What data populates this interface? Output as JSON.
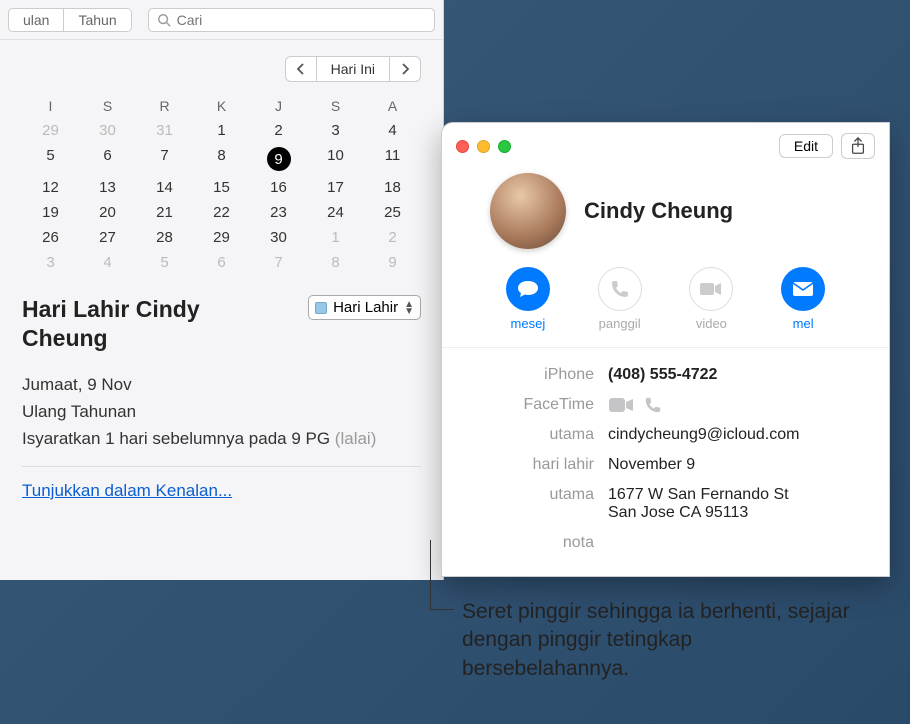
{
  "calendar": {
    "tabs": [
      "ulan",
      "Tahun"
    ],
    "search_placeholder": "Cari",
    "nav": {
      "today": "Hari Ini"
    },
    "dow": [
      "I",
      "S",
      "R",
      "K",
      "J",
      "S",
      "A"
    ],
    "weeks": [
      [
        {
          "d": "29",
          "dim": true
        },
        {
          "d": "30",
          "dim": true
        },
        {
          "d": "31",
          "dim": true
        },
        {
          "d": "1"
        },
        {
          "d": "2"
        },
        {
          "d": "3"
        },
        {
          "d": "4"
        }
      ],
      [
        {
          "d": "5"
        },
        {
          "d": "6"
        },
        {
          "d": "7"
        },
        {
          "d": "8"
        },
        {
          "d": "9",
          "today": true
        },
        {
          "d": "10"
        },
        {
          "d": "11"
        }
      ],
      [
        {
          "d": "12"
        },
        {
          "d": "13"
        },
        {
          "d": "14"
        },
        {
          "d": "15"
        },
        {
          "d": "16"
        },
        {
          "d": "17"
        },
        {
          "d": "18"
        }
      ],
      [
        {
          "d": "19"
        },
        {
          "d": "20"
        },
        {
          "d": "21"
        },
        {
          "d": "22"
        },
        {
          "d": "23"
        },
        {
          "d": "24"
        },
        {
          "d": "25"
        }
      ],
      [
        {
          "d": "26"
        },
        {
          "d": "27"
        },
        {
          "d": "28"
        },
        {
          "d": "29"
        },
        {
          "d": "30"
        },
        {
          "d": "1",
          "dim": true
        },
        {
          "d": "2",
          "dim": true
        }
      ],
      [
        {
          "d": "3",
          "dim": true
        },
        {
          "d": "4",
          "dim": true
        },
        {
          "d": "5",
          "dim": true
        },
        {
          "d": "6",
          "dim": true
        },
        {
          "d": "7",
          "dim": true
        },
        {
          "d": "8",
          "dim": true
        },
        {
          "d": "9",
          "dim": true
        }
      ]
    ],
    "event_title": "Hari Lahir Cindy Cheung",
    "event_category": "Hari Lahir",
    "detail_date": "Jumaat, 9 Nov",
    "detail_repeat": "Ulang Tahunan",
    "detail_alert_prefix": "Isyaratkan 1 hari sebelumnya pada 9 PG ",
    "detail_alert_suffix": "(lalai)",
    "show_link": "Tunjukkan dalam Kenalan..."
  },
  "contacts": {
    "edit": "Edit",
    "name": "Cindy Cheung",
    "actions": {
      "message": "mesej",
      "call": "panggil",
      "video": "video",
      "mail": "mel"
    },
    "fields": {
      "iphone_label": "iPhone",
      "iphone_value": "(408) 555-4722",
      "facetime_label": "FaceTime",
      "email_label": "utama",
      "email_value": "cindycheung9@icloud.com",
      "bday_label": "hari lahir",
      "bday_value": "November 9",
      "addr_label": "utama",
      "addr_line1": "1677 W San Fernando St",
      "addr_line2": "San Jose CA 95113",
      "note_label": "nota"
    }
  },
  "annotation": "Seret pinggir sehingga ia berhenti, sejajar dengan pinggir tetingkap bersebelahannya."
}
